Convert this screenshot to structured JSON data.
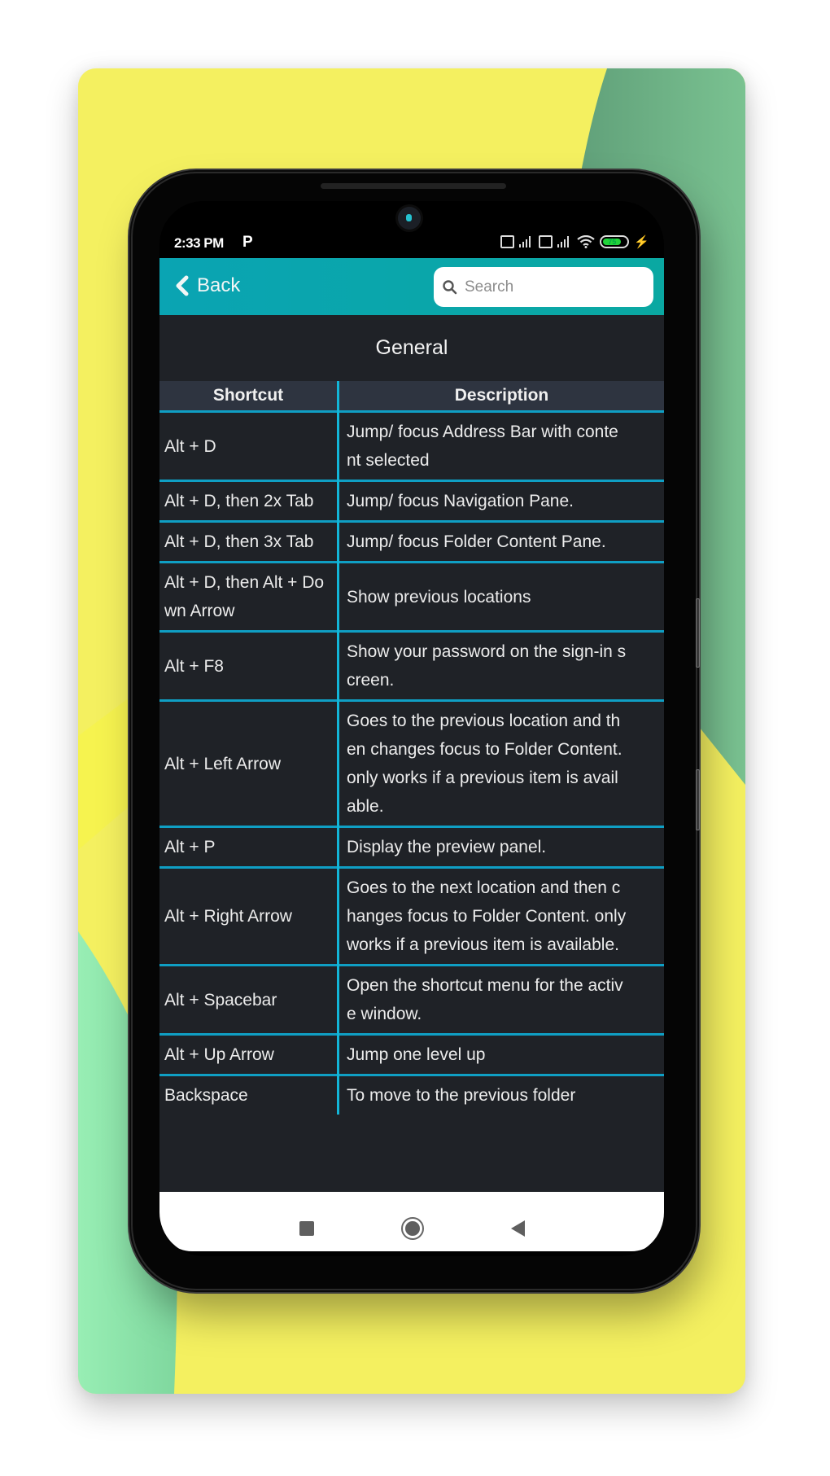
{
  "colors": {
    "card_yellow": "#f4f060",
    "card_green": "#7ac291",
    "card_mint": "#98eeb4",
    "header_teal": "#0aa6ab",
    "table_bg": "#1f2227",
    "table_header_bg": "#2e3440",
    "grid_line": "#12b6d8"
  },
  "status_bar": {
    "time": "2:33 PM",
    "notification_icon": "P",
    "battery_level": "75",
    "icons": [
      "sim1-signal-icon",
      "sim2-signal-icon",
      "wifi-icon",
      "battery-icon",
      "charging-bolt-icon"
    ]
  },
  "header": {
    "back_label": "Back",
    "search_placeholder": "Search",
    "search_value": ""
  },
  "section": {
    "title": "General"
  },
  "table": {
    "columns": [
      "Shortcut",
      "Description"
    ],
    "rows": [
      {
        "shortcut": "Alt + D",
        "description": [
          "Jump/ focus Address Bar with conte",
          "nt selected"
        ]
      },
      {
        "shortcut": "Alt + D, then 2x Tab",
        "description": [
          "Jump/ focus Navigation Pane."
        ]
      },
      {
        "shortcut": "Alt + D, then 3x Tab",
        "description": [
          "Jump/ focus Folder Content Pane."
        ]
      },
      {
        "shortcut": "Alt + D, then Alt + Down Arrow",
        "description": [
          "Show previous locations"
        ]
      },
      {
        "shortcut": "Alt + F8",
        "description": [
          "Show your password on the sign-in s",
          "creen."
        ]
      },
      {
        "shortcut": "Alt + Left Arrow",
        "description": [
          "Goes to the previous location and th",
          "en changes focus to Folder Content.",
          "only works if a previous item is avail",
          "able."
        ]
      },
      {
        "shortcut": "Alt + P",
        "description": [
          "Display the preview panel."
        ]
      },
      {
        "shortcut": "Alt + Right Arrow",
        "description": [
          "Goes to the next location and then c",
          "hanges focus to Folder Content. only",
          "works if a previous item is available."
        ]
      },
      {
        "shortcut": "Alt + Spacebar",
        "description": [
          "Open the shortcut menu for the activ",
          "e window."
        ]
      },
      {
        "shortcut": "Alt + Up Arrow",
        "description": [
          "Jump one level up"
        ]
      },
      {
        "shortcut": "Backspace",
        "description": [
          "To move to the previous folder"
        ]
      }
    ]
  },
  "navbar": {
    "buttons": [
      "recents",
      "home",
      "back"
    ]
  }
}
